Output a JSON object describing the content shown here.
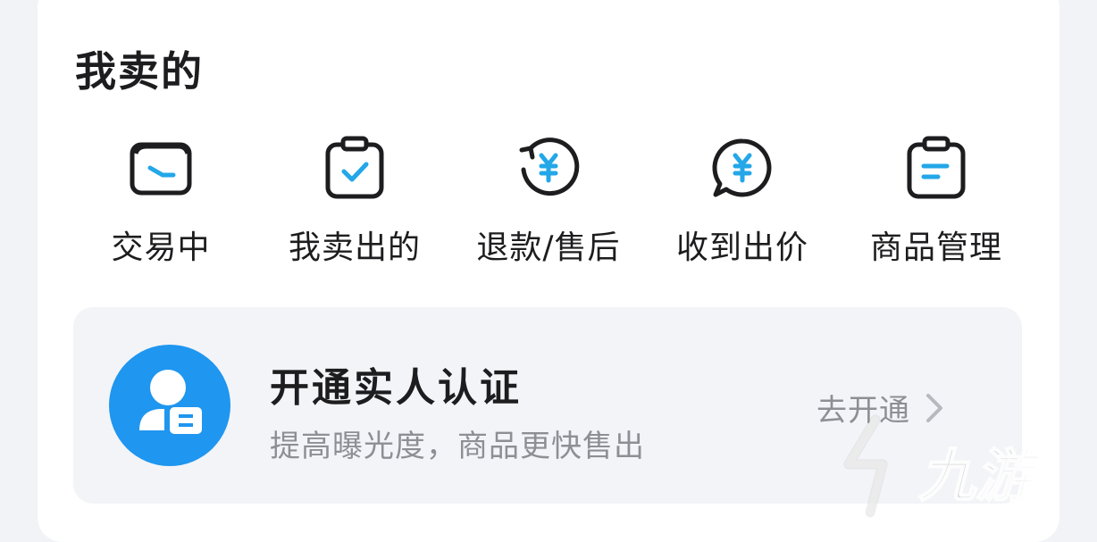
{
  "section": {
    "title": "我卖的"
  },
  "actions": [
    {
      "label": "交易中",
      "icon": "wallet-icon"
    },
    {
      "label": "我卖出的",
      "icon": "clipboard-check-icon"
    },
    {
      "label": "退款/售后",
      "icon": "refund-yen-icon"
    },
    {
      "label": "收到出价",
      "icon": "offer-bubble-yen-icon"
    },
    {
      "label": "商品管理",
      "icon": "clipboard-list-icon"
    }
  ],
  "verify": {
    "title": "开通实人认证",
    "subtitle": "提高曝光度，商品更快售出",
    "action_label": "去开通",
    "avatar_icon": "user-id-card-icon"
  },
  "watermark": {
    "text": "九游"
  },
  "colors": {
    "accent": "#1f96ef",
    "icon_stroke": "#1d1d1f",
    "icon_accent": "#23a7e8",
    "muted_text": "#8e8f94"
  }
}
